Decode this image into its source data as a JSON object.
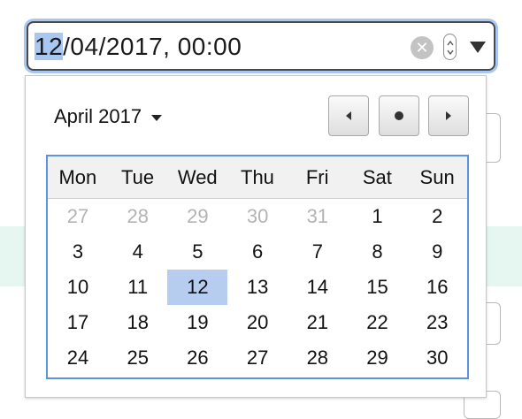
{
  "input": {
    "segment_day": "12",
    "rest_value": "/04/2017, 00:00",
    "clear_glyph": "✕"
  },
  "popup": {
    "month_label": "April 2017",
    "weekdays": [
      "Mon",
      "Tue",
      "Wed",
      "Thu",
      "Fri",
      "Sat",
      "Sun"
    ],
    "weeks": [
      [
        {
          "d": "27",
          "other": true
        },
        {
          "d": "28",
          "other": true
        },
        {
          "d": "29",
          "other": true
        },
        {
          "d": "30",
          "other": true
        },
        {
          "d": "31",
          "other": true
        },
        {
          "d": "1"
        },
        {
          "d": "2"
        }
      ],
      [
        {
          "d": "3"
        },
        {
          "d": "4"
        },
        {
          "d": "5"
        },
        {
          "d": "6"
        },
        {
          "d": "7"
        },
        {
          "d": "8"
        },
        {
          "d": "9"
        }
      ],
      [
        {
          "d": "10"
        },
        {
          "d": "11"
        },
        {
          "d": "12",
          "selected": true
        },
        {
          "d": "13"
        },
        {
          "d": "14"
        },
        {
          "d": "15"
        },
        {
          "d": "16"
        }
      ],
      [
        {
          "d": "17"
        },
        {
          "d": "18"
        },
        {
          "d": "19"
        },
        {
          "d": "20"
        },
        {
          "d": "21"
        },
        {
          "d": "22"
        },
        {
          "d": "23"
        }
      ],
      [
        {
          "d": "24"
        },
        {
          "d": "25"
        },
        {
          "d": "26"
        },
        {
          "d": "27"
        },
        {
          "d": "28"
        },
        {
          "d": "29"
        },
        {
          "d": "30"
        }
      ]
    ]
  },
  "colors": {
    "focus_ring": "#a7c7f2",
    "selected_day": "#b7cdef",
    "calendar_border": "#5a93e0",
    "background_band": "#e6f6f0"
  }
}
